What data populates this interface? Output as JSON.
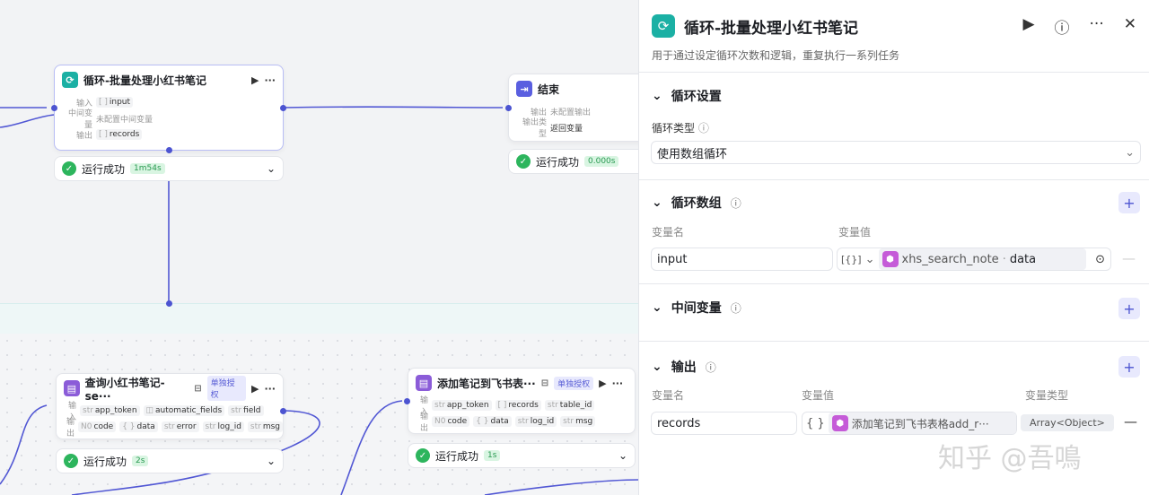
{
  "canvas": {
    "loop_node": {
      "title": "循环-批量处理小红书笔记",
      "in_label": "输入",
      "in_value": "input",
      "mid_label": "中间变量",
      "mid_value": "未配置中间变量",
      "out_label": "输出",
      "out_value": "records",
      "status": "运行成功",
      "time": "1m54s"
    },
    "end_node": {
      "title": "结束",
      "out_label": "输出",
      "out_value": "未配置输出",
      "type_label": "输出类型",
      "type_value": "返回变量",
      "status": "运行成功",
      "time": "0.000s"
    },
    "query_node": {
      "title": "查询小红书笔记-se···",
      "auth": "单独授权",
      "in_label": "输入",
      "inputs": [
        "app_token",
        "automatic_fields",
        "field"
      ],
      "in_types": [
        "str",
        "◫",
        "str"
      ],
      "out_label": "输出",
      "outputs": [
        "code",
        "data",
        "error",
        "log_id",
        "msg"
      ],
      "out_types": [
        "N0",
        "{ }",
        "str",
        "str",
        "str"
      ],
      "status": "运行成功",
      "time": "2s"
    },
    "add_node": {
      "title": "添加笔记到飞书表···",
      "auth": "单独授权",
      "in_label": "输入",
      "inputs": [
        "app_token",
        "records",
        "table_id"
      ],
      "in_types": [
        "str",
        "[ ]",
        "str"
      ],
      "out_label": "输出",
      "outputs": [
        "code",
        "data",
        "log_id",
        "msg"
      ],
      "out_types": [
        "N0",
        "{ }",
        "str",
        "str"
      ],
      "status": "运行成功",
      "time": "1s"
    }
  },
  "panel": {
    "title": "循环-批量处理小红书笔记",
    "subtitle": "用于通过设定循环次数和逻辑，重复执行一系列任务",
    "loop_settings": {
      "heading": "循环设置",
      "type_label": "循环类型",
      "type_value": "使用数组循环"
    },
    "loop_array": {
      "heading": "循环数组",
      "name_label": "变量名",
      "value_label": "变量值",
      "name": "input",
      "type_glyph": "[{}]",
      "ref_node": "xhs_search_note",
      "ref_field": "data"
    },
    "intermediate": {
      "heading": "中间变量"
    },
    "output": {
      "heading": "输出",
      "name_label": "变量名",
      "value_label": "变量值",
      "type_label": "变量类型",
      "name": "records",
      "type_glyph": "{ }",
      "ref": "添加笔记到飞书表格add_r···",
      "type": "Array<Object>"
    }
  },
  "watermark": "知乎 @吾鳴",
  "colors": {
    "accent": "#4c54d1",
    "loop": "#1bb0a4",
    "success": "#2db55d"
  }
}
